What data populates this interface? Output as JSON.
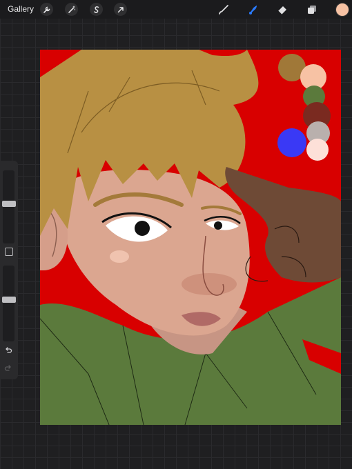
{
  "toolbar": {
    "gallery_label": "Gallery",
    "left_tools": [
      "wrench-icon",
      "magic-wand-icon",
      "selection-icon",
      "transform-arrow-icon"
    ],
    "right_tools": [
      "brush-icon",
      "smudge-icon",
      "eraser-icon",
      "layers-icon"
    ],
    "active_tool": "smudge-icon",
    "active_color": "#f7c2a4",
    "accent_color": "#2a7bff"
  },
  "sidebar": {
    "brush_size_level": 0.55,
    "opacity_level": 0.35,
    "undo_icon": "undo-icon",
    "redo_icon": "redo-icon"
  },
  "canvas_palette": [
    "#a07838",
    "#f7c2a4",
    "#5b7a3c",
    "#7a2a20",
    "#b9b0ad",
    "#3a39f5",
    "#fde0d8"
  ],
  "artwork_colors": {
    "background": "#d80000",
    "hair": "#b89043",
    "skin": "#dba690",
    "shirt": "#5b7a3c",
    "hand": "#6e4a36"
  }
}
